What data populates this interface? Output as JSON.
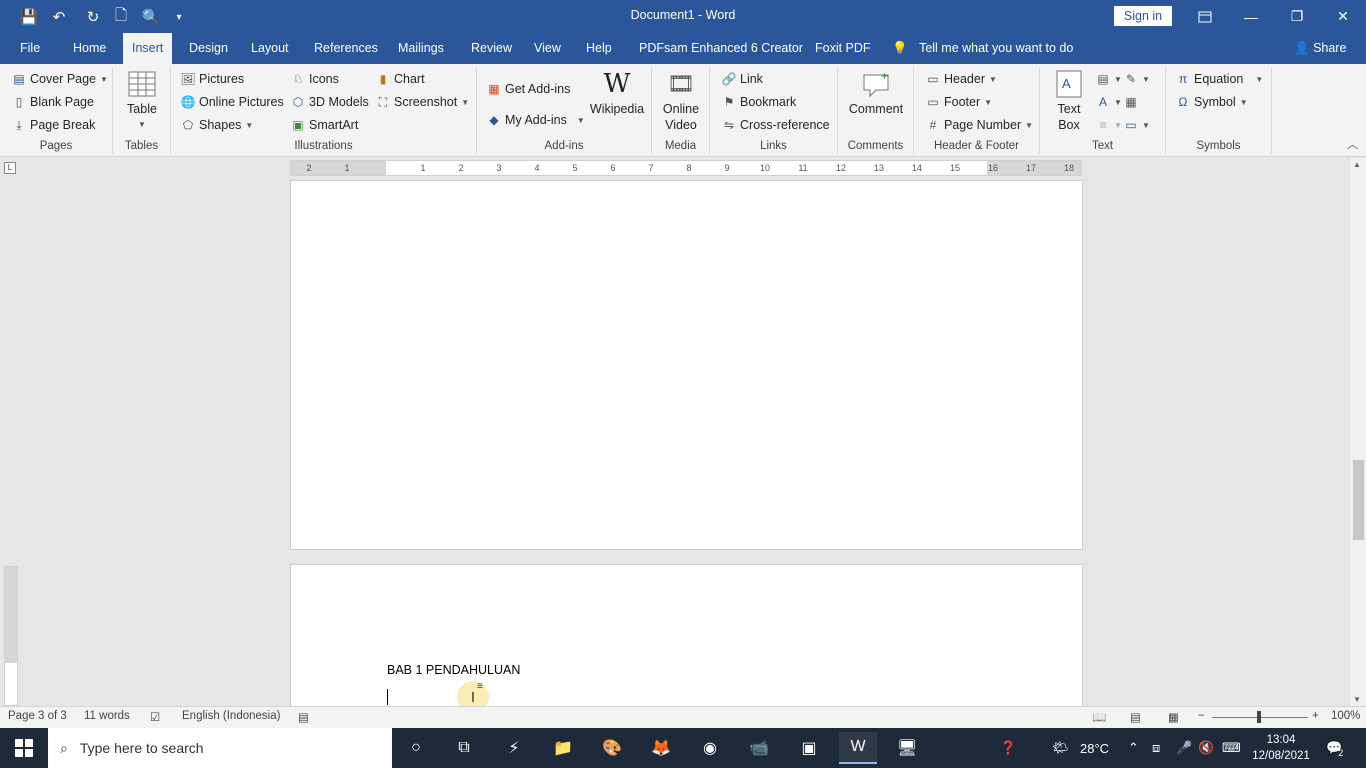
{
  "window": {
    "title": "Document1  -  Word",
    "sign_in": "Sign in",
    "minimize_glyph": "—",
    "restore_glyph": "❐",
    "close_glyph": "✕"
  },
  "quick_access": {
    "save_glyph": "💾",
    "undo_glyph": "↶",
    "redo_glyph": "↻",
    "new_glyph": "🗋",
    "print_preview_glyph": "🔍",
    "customize_glyph": "▾"
  },
  "tabs": [
    "File",
    "Home",
    "Insert",
    "Design",
    "Layout",
    "References",
    "Mailings",
    "Review",
    "View",
    "Help",
    "PDFsam Enhanced 6 Creator",
    "Foxit PDF"
  ],
  "active_tab": "Insert",
  "tell_me": "Tell me what you want to do",
  "share": "Share",
  "ribbon": {
    "pages": {
      "label": "Pages",
      "cover_page": "Cover Page",
      "blank_page": "Blank Page",
      "page_break": "Page Break"
    },
    "tables": {
      "label": "Tables",
      "table": "Table"
    },
    "illustrations": {
      "label": "Illustrations",
      "pictures": "Pictures",
      "online_pictures": "Online Pictures",
      "shapes": "Shapes",
      "icons": "Icons",
      "models_3d": "3D Models",
      "smartart": "SmartArt",
      "chart": "Chart",
      "screenshot": "Screenshot"
    },
    "addins": {
      "label": "Add-ins",
      "get_addins": "Get Add-ins",
      "my_addins": "My Add-ins",
      "wikipedia": "Wikipedia"
    },
    "media": {
      "label": "Media",
      "online_video_1": "Online",
      "online_video_2": "Video"
    },
    "links": {
      "label": "Links",
      "link": "Link",
      "bookmark": "Bookmark",
      "cross_reference": "Cross-reference"
    },
    "comments": {
      "label": "Comments",
      "comment": "Comment"
    },
    "header_footer": {
      "label": "Header & Footer",
      "header": "Header",
      "footer": "Footer",
      "page_number": "Page Number"
    },
    "text": {
      "label": "Text",
      "text_box_1": "Text",
      "text_box_2": "Box"
    },
    "symbols": {
      "label": "Symbols",
      "equation": "Equation",
      "symbol": "Symbol"
    }
  },
  "ruler": {
    "ticks": [
      "2",
      "1",
      "1",
      "2",
      "3",
      "4",
      "5",
      "6",
      "7",
      "8",
      "9",
      "10",
      "11",
      "12",
      "13",
      "14",
      "15",
      "16",
      "17",
      "18"
    ]
  },
  "document": {
    "heading": "BAB 1 PENDAHULUAN"
  },
  "status": {
    "page": "Page 3 of 3",
    "words": "11 words",
    "language": "English (Indonesia)",
    "zoom": "100%"
  },
  "taskbar": {
    "search_placeholder": "Type here to search",
    "temperature": "28°C",
    "time": "13:04",
    "date": "12/08/2021",
    "notifications": "2"
  }
}
